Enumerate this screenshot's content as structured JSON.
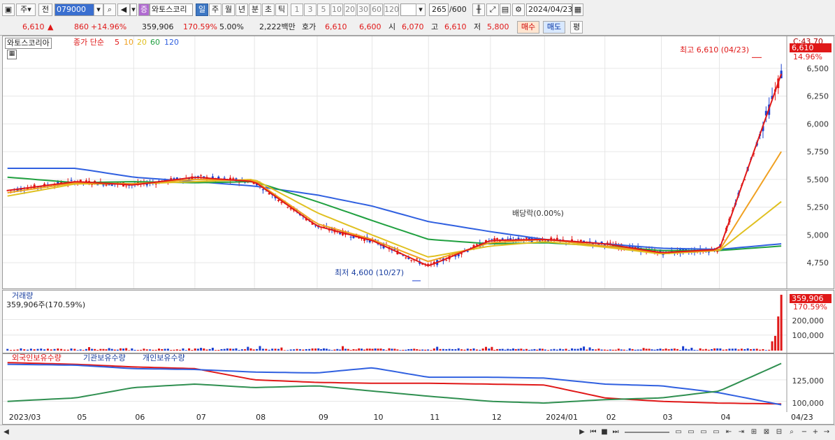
{
  "toolbar": {
    "jong": "주",
    "jeon": "전",
    "code": "079000",
    "jeung": "증",
    "name": "와토스코리",
    "periods": [
      "일",
      "주",
      "월",
      "년",
      "분",
      "초",
      "틱"
    ],
    "mins": [
      "1",
      "3",
      "5",
      "10",
      "20",
      "30",
      "60",
      "120"
    ],
    "count": "265",
    "count_total": "/600",
    "date": "2024/04/23"
  },
  "quote": {
    "price": "6,610",
    "arrow": "▲",
    "change": "860",
    "pct": "+14.96%",
    "volume": "359,906",
    "vol_ratio": "170.59%",
    "turnover": "5.00%",
    "amount": "2,222백만",
    "hoga_label": "호가",
    "hoga1": "6,610",
    "hoga2": "6,600",
    "open_label": "시",
    "open": "6,070",
    "high_label": "고",
    "high": "6,610",
    "low_label": "저",
    "low": "5,800",
    "buy": "매수",
    "sell": "매도",
    "avg": "평"
  },
  "legend": {
    "name": "와토스코리아",
    "kind": "종가 단순",
    "ma": [
      "5",
      "10",
      "20",
      "60",
      "120"
    ]
  },
  "price_axis": {
    "ticks": [
      "6,500",
      "6,250",
      "6,000",
      "5,750",
      "5,500",
      "5,250",
      "5,000",
      "4,750"
    ],
    "top_cut": "C:43.70",
    "cur": "6,610",
    "cur_pct": "14.96%"
  },
  "annotations": {
    "high": "최고 6,610 (04/23)",
    "low": "최저 4,600 (10/27)",
    "dividend": "배당락(0.00%)"
  },
  "volume_panel": {
    "title": "거래량",
    "sub": "359,906주(170.59%)",
    "ticks": [
      "200,000",
      "100,000"
    ],
    "cur": "359,906",
    "cur_pct": "170.59%"
  },
  "holding_panel": {
    "foreign": "외국인보유수량",
    "inst": "기관보유수량",
    "indiv": "개인보유수량",
    "ticks": [
      "125,000",
      "100,000"
    ]
  },
  "x_axis": {
    "labels": [
      "2023/03",
      "05",
      "06",
      "07",
      "08",
      "09",
      "10",
      "11",
      "12",
      "2024/01",
      "02",
      "03",
      "04",
      "04/23"
    ]
  },
  "chart_data": [
    {
      "type": "line",
      "title": "와토스코리아",
      "note": "candlestick price chart with moving averages 5/10/20/60/120",
      "ylim": [
        4600,
        6650
      ],
      "x": [
        "2023/03",
        "05",
        "06",
        "07",
        "08",
        "09",
        "10",
        "11",
        "12",
        "2024/01",
        "02",
        "03",
        "04",
        "04/23"
      ],
      "series": [
        {
          "name": "5",
          "values": [
            5400,
            5480,
            5450,
            5520,
            5480,
            5080,
            4950,
            4720,
            4950,
            4960,
            4920,
            4840,
            4870,
            6450
          ]
        },
        {
          "name": "10",
          "values": [
            5380,
            5470,
            5460,
            5500,
            5490,
            5100,
            4960,
            4760,
            4930,
            4960,
            4900,
            4840,
            4860,
            5750
          ]
        },
        {
          "name": "20",
          "values": [
            5350,
            5460,
            5460,
            5480,
            5500,
            5200,
            5000,
            4800,
            4900,
            4940,
            4890,
            4830,
            4860,
            5300
          ]
        },
        {
          "name": "60",
          "values": [
            5520,
            5470,
            5480,
            5470,
            5480,
            5300,
            5130,
            4960,
            4920,
            4930,
            4900,
            4860,
            4860,
            4900
          ]
        },
        {
          "name": "120",
          "values": [
            5600,
            5600,
            5520,
            5480,
            5440,
            5360,
            5260,
            5120,
            5030,
            4960,
            4920,
            4880,
            4870,
            4920
          ]
        }
      ],
      "low": {
        "value": 4600,
        "date": "10/27"
      },
      "high": {
        "value": 6610,
        "date": "04/23"
      },
      "color_map": {
        "up": "#e01818",
        "down": "#1a3fd0",
        "ma5": "#e01818",
        "ma10": "#f0a020",
        "ma20": "#e0c020",
        "ma60": "#20a040",
        "ma120": "#3060e0"
      }
    },
    {
      "type": "bar",
      "title": "거래량",
      "ylim": [
        0,
        360000
      ],
      "last_value": 359906
    },
    {
      "type": "line",
      "title": "보유수량",
      "ylim": [
        90000,
        150000
      ],
      "series": [
        {
          "name": "외국인보유수량",
          "values": [
            145000,
            143000,
            140000,
            138000,
            125000,
            122000,
            121000,
            121000,
            120000,
            119000,
            104000,
            100000,
            98000,
            97000
          ]
        },
        {
          "name": "기관보유수량",
          "values": [
            143000,
            142000,
            138000,
            137000,
            134000,
            133000,
            139000,
            128000,
            128000,
            127000,
            120000,
            118000,
            110000,
            96000
          ]
        },
        {
          "name": "개인보유수량",
          "values": [
            100000,
            104000,
            116000,
            120000,
            116000,
            118000,
            112000,
            106000,
            100000,
            98000,
            102000,
            104000,
            112000,
            144000
          ]
        }
      ]
    }
  ]
}
